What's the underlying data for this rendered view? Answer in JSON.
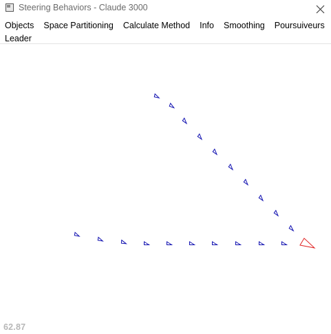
{
  "window": {
    "title": "Steering Behaviors - Claude 3000"
  },
  "menu": {
    "items": [
      "Objects",
      "Space Partitioning",
      "Calculate Method",
      "Info",
      "Smoothing",
      "Poursuiveurs"
    ],
    "second_row": [
      "Leader"
    ]
  },
  "status": {
    "fps": "62.87"
  },
  "scene": {
    "leader_color": "#e02020",
    "follower_color": "#1010b0",
    "leader_icon": "red-triangle-leader",
    "follower_icon": "blue-triangle-agent",
    "follower_count": 20
  }
}
